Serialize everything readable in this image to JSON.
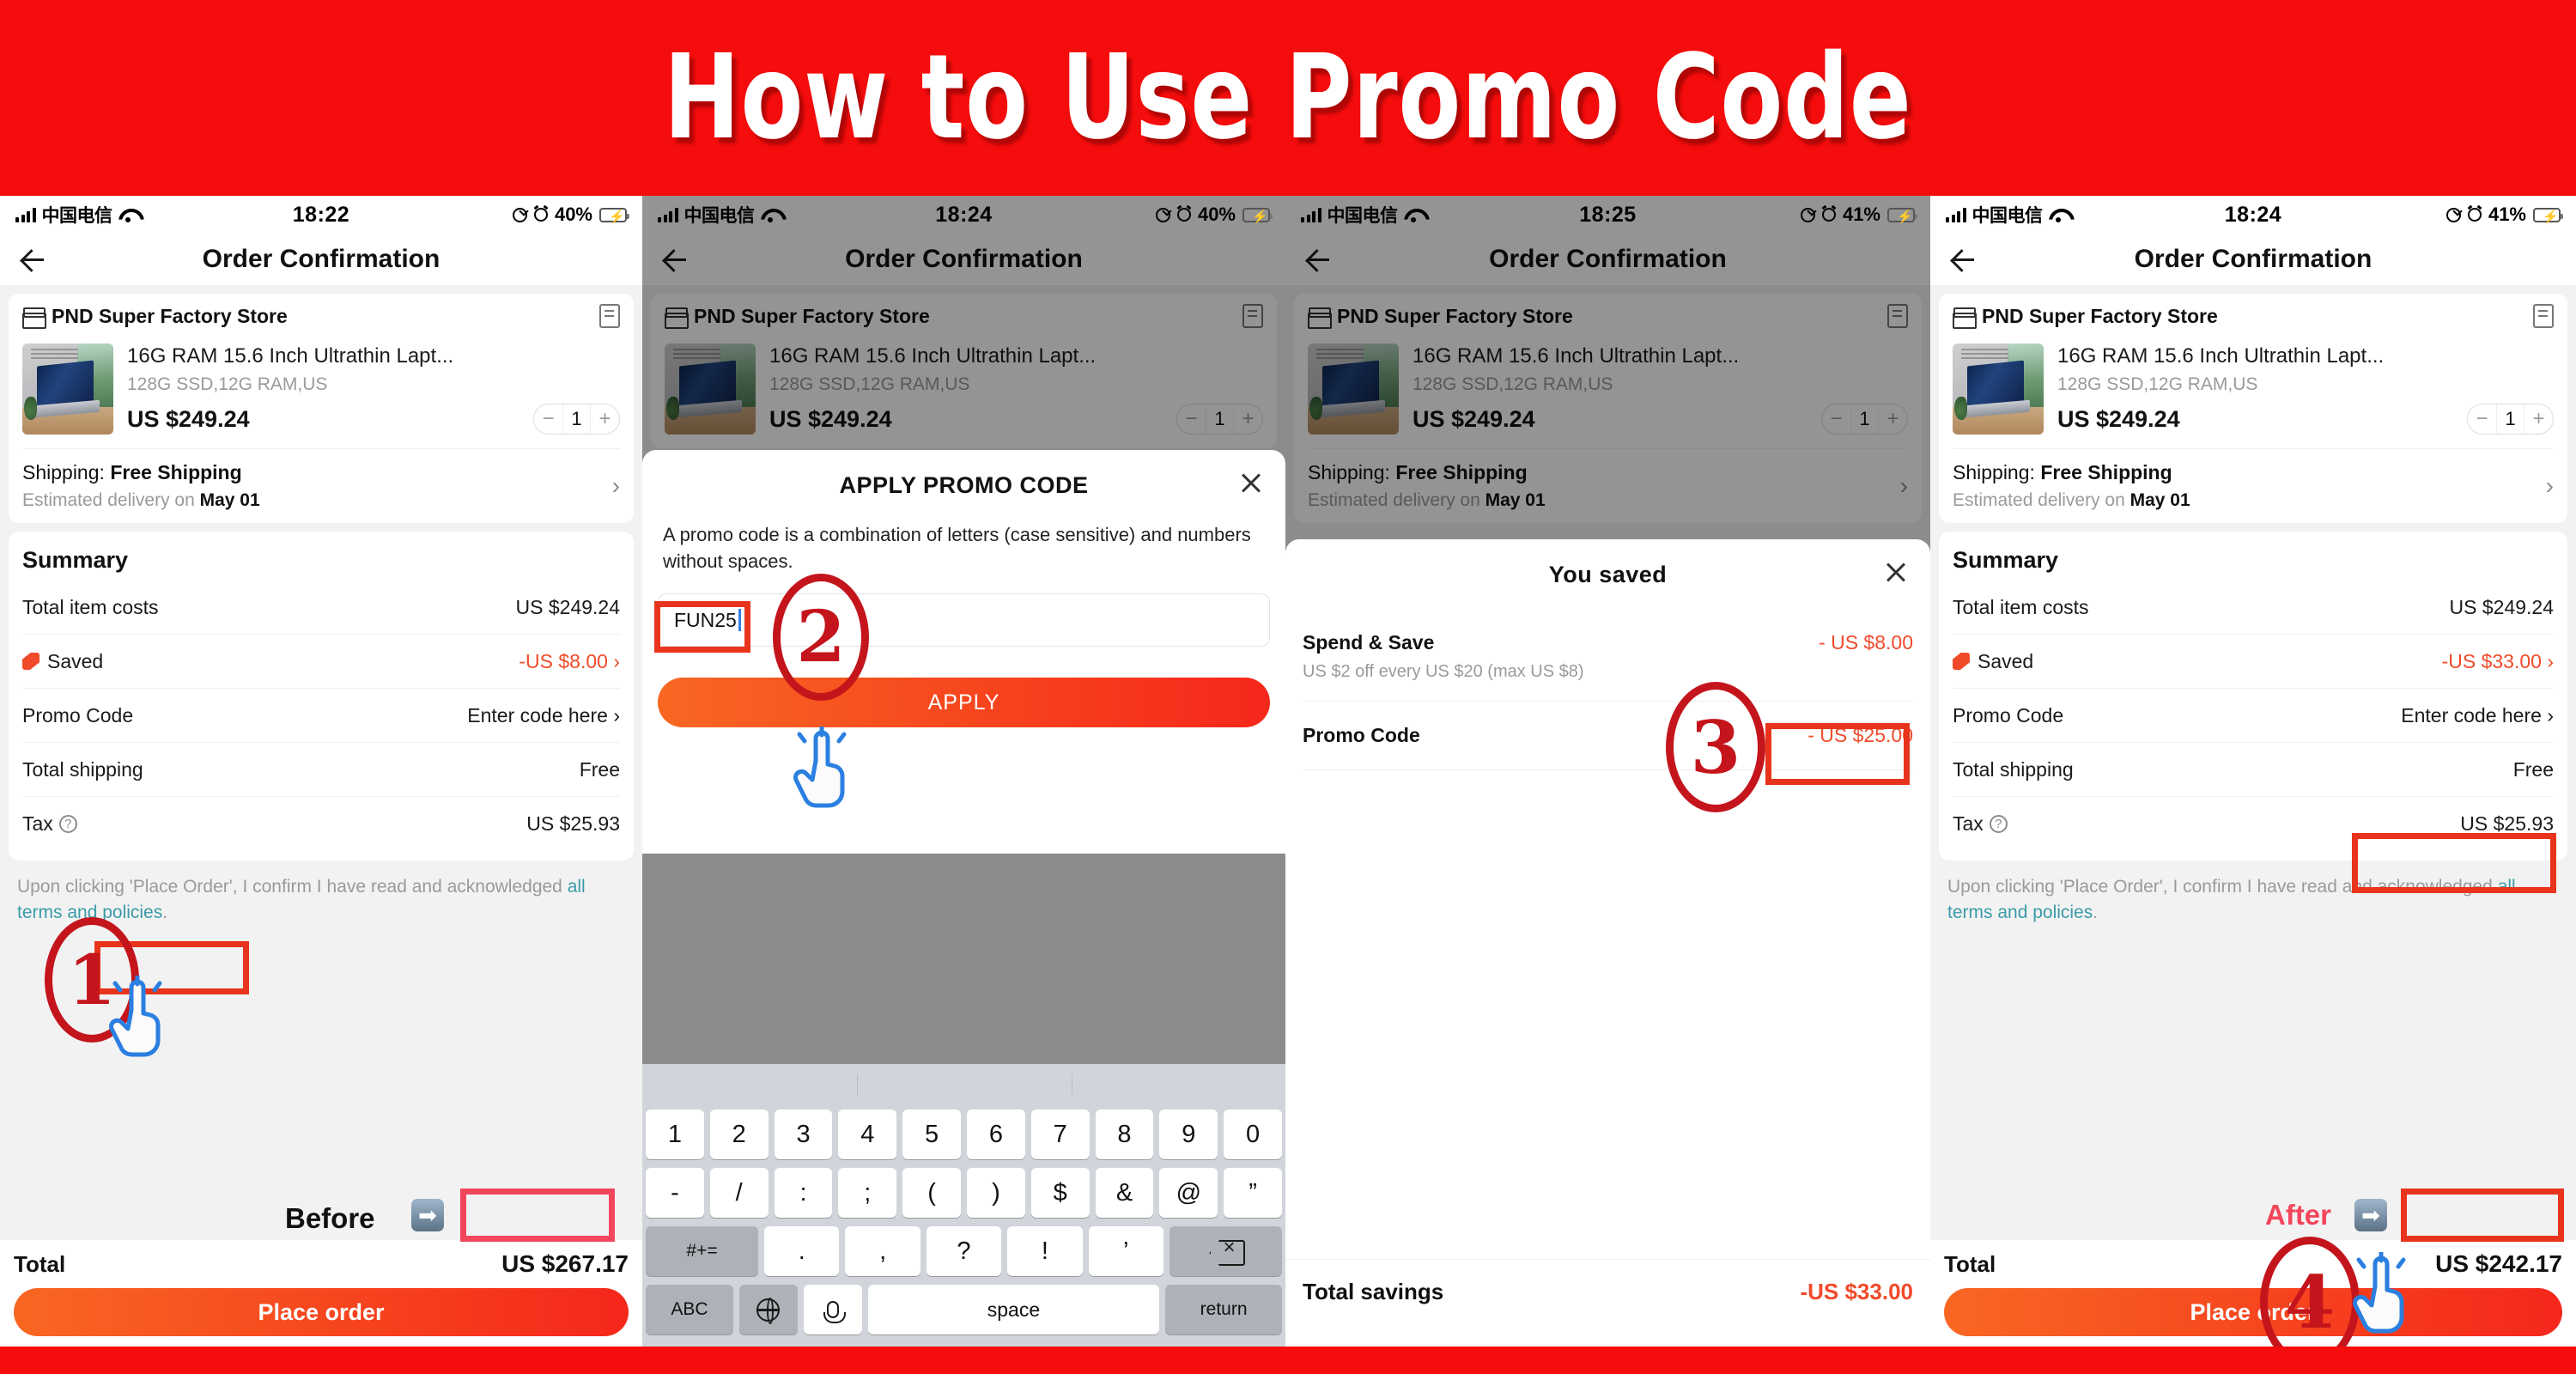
{
  "banner": {
    "title": "How to Use Promo Code"
  },
  "common": {
    "carrier": "中国电信",
    "nav_title": "Order Confirmation",
    "store_name": "PND Super Factory Store",
    "product_title": "16G RAM 15.6 Inch Ultrathin Lapt...",
    "product_sku": "128G SSD,12G RAM,US",
    "product_price": "US $249.24",
    "qty": "1",
    "shipping_label": "Shipping: ",
    "shipping_value": "Free Shipping",
    "eta_prefix": "Estimated delivery on ",
    "eta_date": "May 01",
    "summary_title": "Summary",
    "row_total_item": "Total item costs",
    "row_total_item_val": "US $249.24",
    "row_saved": "Saved",
    "row_promo": "Promo Code",
    "row_promo_val": "Enter code here",
    "row_shipping": "Total shipping",
    "row_shipping_val": "Free",
    "row_tax": "Tax",
    "row_tax_val": "US $25.93",
    "terms_pre": "Upon clicking 'Place Order', I confirm I have read and acknowledged ",
    "terms_link": "all terms and policies",
    "terms_post": ".",
    "total_label": "Total",
    "place_order": "Place order"
  },
  "panel1": {
    "time": "18:22",
    "battery": "40%",
    "saved_val": "-US $8.00",
    "promo_val": "Enter code here",
    "total_val": "US $267.17",
    "step_num": "1",
    "ba_word": "Before",
    "arrow": "➡"
  },
  "panel2": {
    "time": "18:24",
    "battery": "40%",
    "modal_title": "APPLY PROMO CODE",
    "modal_desc": "A promo code is a combination of letters (case sensitive) and numbers without spaces.",
    "input_value": "FUN25",
    "apply_label": "APPLY",
    "step_num": "2",
    "keyboard": {
      "row1": [
        "1",
        "2",
        "3",
        "4",
        "5",
        "6",
        "7",
        "8",
        "9",
        "0"
      ],
      "row2": [
        "-",
        "/",
        ":",
        ";",
        "(",
        ")",
        "$",
        "&",
        "@",
        "”"
      ],
      "row3_left": "#+=",
      "row3_mid": [
        ".",
        ",",
        "?",
        "!",
        "’"
      ],
      "row3_right": "delete-icon",
      "row4": [
        "ABC",
        "globe-icon",
        "mic-icon",
        "space",
        "return"
      ]
    }
  },
  "panel3": {
    "time": "18:25",
    "battery": "41%",
    "sheet_title": "You saved",
    "rows": [
      {
        "label": "Spend & Save",
        "sub": "US $2 off every US $20 (max US $8)",
        "value": "- US $8.00"
      },
      {
        "label": "Promo Code",
        "sub": "",
        "value": "- US $25.00"
      }
    ],
    "total_label": "Total savings",
    "total_value": "-US $33.00",
    "step_num": "3"
  },
  "panel4": {
    "time": "18:24",
    "battery": "41%",
    "saved_val": "-US $33.00",
    "promo_val": "Enter code here",
    "total_val": "US $242.17",
    "step_num": "4",
    "ba_word": "After",
    "arrow": "➡"
  },
  "colors": {
    "brand_red": "#f50c0c",
    "accent_orange": "#f04a2a",
    "annotation_red": "#c4151c",
    "highlight_red": "#e8341c",
    "link_teal": "#3a9ba8"
  }
}
